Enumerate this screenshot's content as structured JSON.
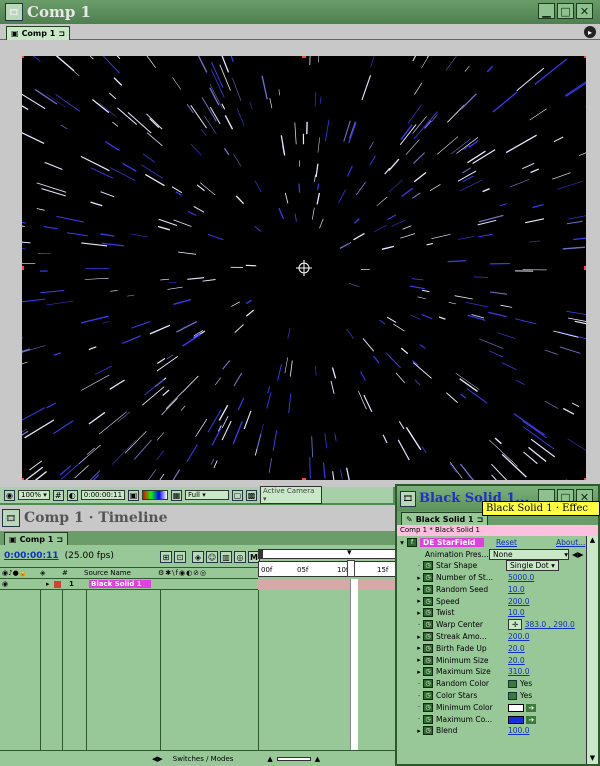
{
  "comp_window": {
    "title": "Comp 1",
    "tab_label": "Comp 1",
    "controls": {
      "minimize": "▁",
      "maximize": "□",
      "close": "✕"
    },
    "footer": {
      "zoom": "100%",
      "timecode": "0:00:00:11",
      "resolution": "Full",
      "camera": "Active Camera"
    }
  },
  "timeline_window": {
    "title": "Comp 1 · Timeline",
    "tab_label": "Comp 1",
    "timecode": "0:00:00:11",
    "fps": "(25.00 fps)",
    "columns": {
      "number": "#",
      "source_name": "Source Name"
    },
    "ruler_labels": [
      "00f",
      "05f",
      "10f",
      "15f"
    ],
    "layers": [
      {
        "number": "1",
        "name": "Black Solid 1"
      }
    ],
    "footer": {
      "switches_modes": "Switches / Modes"
    }
  },
  "effects_window": {
    "title": "Black Solid 1...",
    "tooltip": "Black Solid 1 · Effec",
    "tab_label": "Black Solid 1",
    "breadcrumb": "Comp 1 * Black Solid 1",
    "effect_name": "DE StarField",
    "reset_label": "Reset",
    "about_label": "About...",
    "animation_presets_label": "Animation Pres...",
    "animation_presets_value": "None",
    "properties": [
      {
        "label": "Star Shape",
        "value": "Single Dot",
        "kind": "dropdown"
      },
      {
        "label": "Number of St...",
        "value": "5000.0",
        "kind": "number"
      },
      {
        "label": "Random Seed",
        "value": "10.0",
        "kind": "number"
      },
      {
        "label": "Speed",
        "value": "200.0",
        "kind": "number"
      },
      {
        "label": "Twist",
        "value": "10.0",
        "kind": "number"
      },
      {
        "label": "Warp Center",
        "value": "383.0 , 290.0",
        "kind": "point"
      },
      {
        "label": "Streak Amo...",
        "value": "200.0",
        "kind": "number"
      },
      {
        "label": "Birth Fade Up",
        "value": "20.0",
        "kind": "number"
      },
      {
        "label": "Minimum Size",
        "value": "20.0",
        "kind": "number"
      },
      {
        "label": "Maximum Size",
        "value": "310.0",
        "kind": "number"
      },
      {
        "label": "Random Color",
        "value": "Yes",
        "kind": "checkbox"
      },
      {
        "label": "Color Stars",
        "value": "Yes",
        "kind": "checkbox"
      },
      {
        "label": "Minimum Color",
        "value": "#ffffff",
        "kind": "color"
      },
      {
        "label": "Maximum Co...",
        "value": "#1030e0",
        "kind": "color"
      },
      {
        "label": "Blend",
        "value": "100.0",
        "kind": "number"
      }
    ]
  },
  "colors": {
    "bg": "#4f8a4f",
    "panel": "#98c898",
    "layer_highlight": "#e040e0",
    "value_blue": "#1030c0",
    "tooltip_bg": "#ffff40",
    "breadcrumb_bg": "#ffc0e0"
  }
}
